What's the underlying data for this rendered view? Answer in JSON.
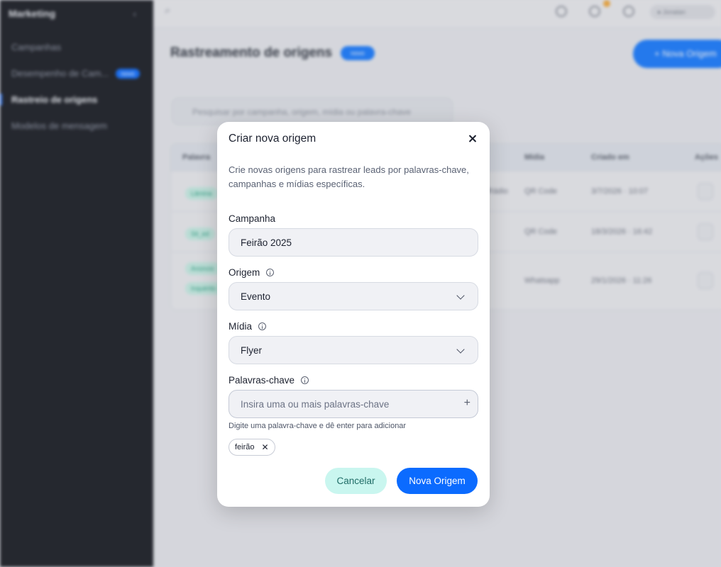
{
  "sidebar": {
    "title": "Marketing",
    "items": [
      {
        "label": "Campanhas"
      },
      {
        "label": "Desempenho de Cam...",
        "badge": "novo"
      },
      {
        "label": "Rastreio de origens",
        "active": true
      },
      {
        "label": "Modelos de mensagem"
      }
    ]
  },
  "topbar": {
    "user_label": "● Jonatan"
  },
  "page": {
    "title": "Rastreamento de origens",
    "badge": "novo",
    "primary_button": "+ Nova Origem",
    "filter_placeholder": "Pesquisar por campanha, origem, mídia ou palavra-chave"
  },
  "table": {
    "columns": [
      "Palavra",
      "Mídia",
      "Criado em",
      "Ações"
    ],
    "rows": [
      {
        "keyword": "Lâmina",
        "origin": "Rádio",
        "media": "QR Code",
        "created": "3/7/2026 · 10:07"
      },
      {
        "keyword": "Sit_ed",
        "origin": "",
        "media": "QR Code",
        "created": "18/3/2026 · 16:42"
      },
      {
        "keyword": "Anúncio",
        "keyword2": "Inquérito",
        "origin": "",
        "media": "Whatsapp",
        "created": "29/1/2026 · 11:26"
      }
    ]
  },
  "modal": {
    "title": "Criar nova origem",
    "description": "Crie novas origens para rastrear leads por palavras-chave, campanhas e mídias específicas.",
    "campaign": {
      "label": "Campanha",
      "value": "Feirão 2025"
    },
    "origin": {
      "label": "Origem",
      "value": "Evento"
    },
    "media": {
      "label": "Mídia",
      "value": "Flyer"
    },
    "keywords": {
      "label": "Palavras-chave",
      "placeholder": "Insira uma ou mais palavras-chave",
      "hint": "Digite uma palavra-chave e dê enter para adicionar",
      "tags": [
        "feirão"
      ]
    },
    "cancel_label": "Cancelar",
    "submit_label": "Nova Origem"
  },
  "colors": {
    "primary": "#0b6bff",
    "cancel_bg": "#c9f6ef",
    "sidebar_bg": "#16181e"
  }
}
